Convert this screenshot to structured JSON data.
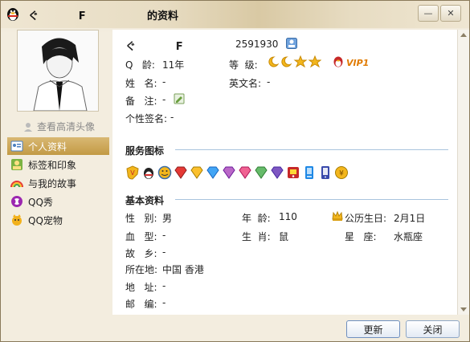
{
  "window": {
    "nickname": "ぐ           F",
    "title_suffix": "的资料",
    "minimize_glyph": "—",
    "close_glyph": "✕"
  },
  "sidebar": {
    "hd_avatar_link": "查看高清头像",
    "items": [
      {
        "label": "个人资料",
        "icon": "profile-card-icon",
        "active": true
      },
      {
        "label": "标签和印象",
        "icon": "tag-icon",
        "active": false
      },
      {
        "label": "与我的故事",
        "icon": "rainbow-icon",
        "active": false
      },
      {
        "label": "QQ秀",
        "icon": "qq-show-icon",
        "active": false
      },
      {
        "label": "QQ宠物",
        "icon": "pet-icon",
        "active": false
      }
    ]
  },
  "profile": {
    "nickname": "ぐ           F",
    "qq_number": "2591930",
    "qq_age_label": "Q   龄:",
    "qq_age": "11年",
    "level_label": "等  级:",
    "vip_text": "VIP1",
    "name_label": "姓   名:",
    "name": "-",
    "english_name_label": "英文名:",
    "english_name": "-",
    "remark_label": "备   注:",
    "remark": "-",
    "signature_label": "个性签名:",
    "signature": "-"
  },
  "services": {
    "title": "服务图标",
    "icons": [
      "shield-icon",
      "qq-penguin-icon",
      "smile-face-icon",
      "red-diamond-icon",
      "yellow-diamond-icon",
      "blue-diamond-icon",
      "purple-diamond-icon",
      "pink-diamond-icon",
      "green-diamond-icon",
      "violet-diamond-icon",
      "game-icon",
      "phone-icon",
      "mobile-icon",
      "coin-icon"
    ]
  },
  "basic_info": {
    "title": "基本资料",
    "gender_label": "性   别:",
    "gender": "男",
    "age_label": "年  龄:",
    "age": "110",
    "lunar_birthday_label": "公历生日:",
    "lunar_birthday": "2月1日",
    "blood_label": "血   型:",
    "blood": "-",
    "zodiac_label": "生  肖:",
    "zodiac": "鼠",
    "constellation_label": "星   座:",
    "constellation": "水瓶座",
    "hometown_label": "故   乡:",
    "hometown": "-",
    "location_label": "所在地:",
    "location": "中国 香港",
    "address_label": "地   址:",
    "address": "-",
    "postcode_label": "邮   编:",
    "postcode": "-"
  },
  "footer": {
    "refresh_label": "更新",
    "close_label": "关闭"
  },
  "colors": {
    "accent_gold": "#c29a44",
    "section_line": "#a9c4de",
    "vip": "#e07a00"
  }
}
